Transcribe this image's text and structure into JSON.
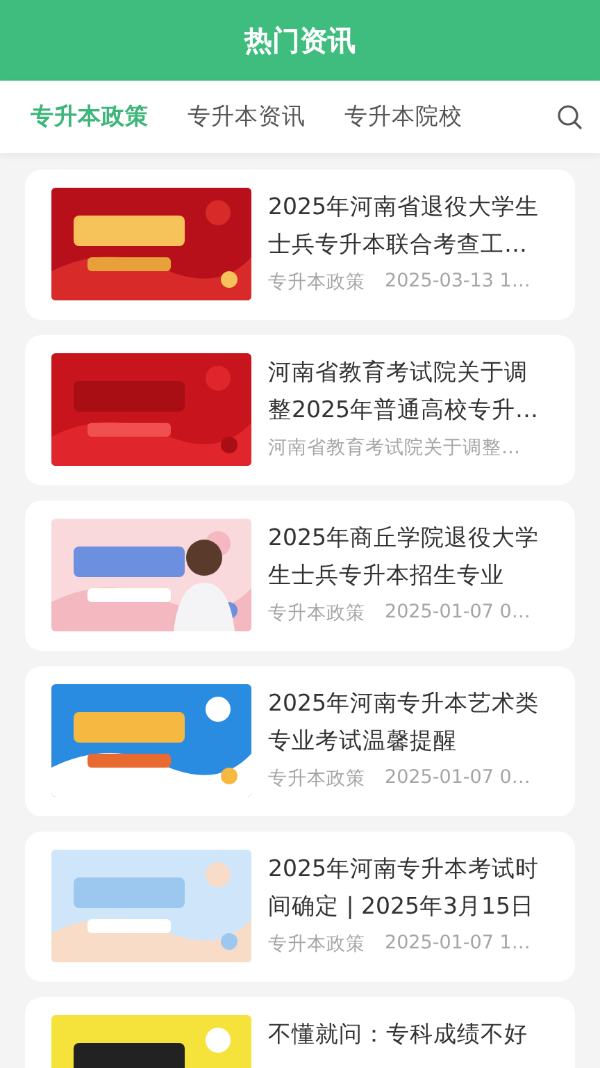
{
  "header": {
    "title": "热门资讯"
  },
  "tabs": [
    {
      "label": "专升本政策",
      "selected": true
    },
    {
      "label": "专升本资讯",
      "selected": false
    },
    {
      "label": "专升本院校",
      "selected": false
    }
  ],
  "articles": [
    {
      "thumbnail": {
        "kind": "picture"
      },
      "title": "2025年河南省退役大学生士兵专升本联合考查工…",
      "meta": [
        "专升本政策",
        "2025-03-13 1…"
      ]
    },
    {
      "thumbnail": {
        "kind": "picture"
      },
      "title": "河南省教育考试院关于调整2025年普通高校专升…",
      "meta": [
        "河南省教育考试院关于调整…"
      ]
    },
    {
      "thumbnail": {
        "kind": "picture"
      },
      "title": "2025年商丘学院退役大学生士兵专升本招生专业",
      "meta": [
        "专升本政策",
        "2025-01-07 0…"
      ]
    },
    {
      "thumbnail": {
        "kind": "picture"
      },
      "title": "2025年河南专升本艺术类专业考试温馨提醒",
      "meta": [
        "专升本政策",
        "2025-01-07 0…"
      ]
    },
    {
      "thumbnail": {
        "kind": "picture"
      },
      "title": "2025年河南专升本考试时间确定 | 2025年3月15日",
      "meta": [
        "专升本政策",
        "2025-01-07 1…"
      ]
    },
    {
      "thumbnail": {
        "kind": "picture"
      },
      "title": "不懂就问：专科成绩不好"
    }
  ]
}
